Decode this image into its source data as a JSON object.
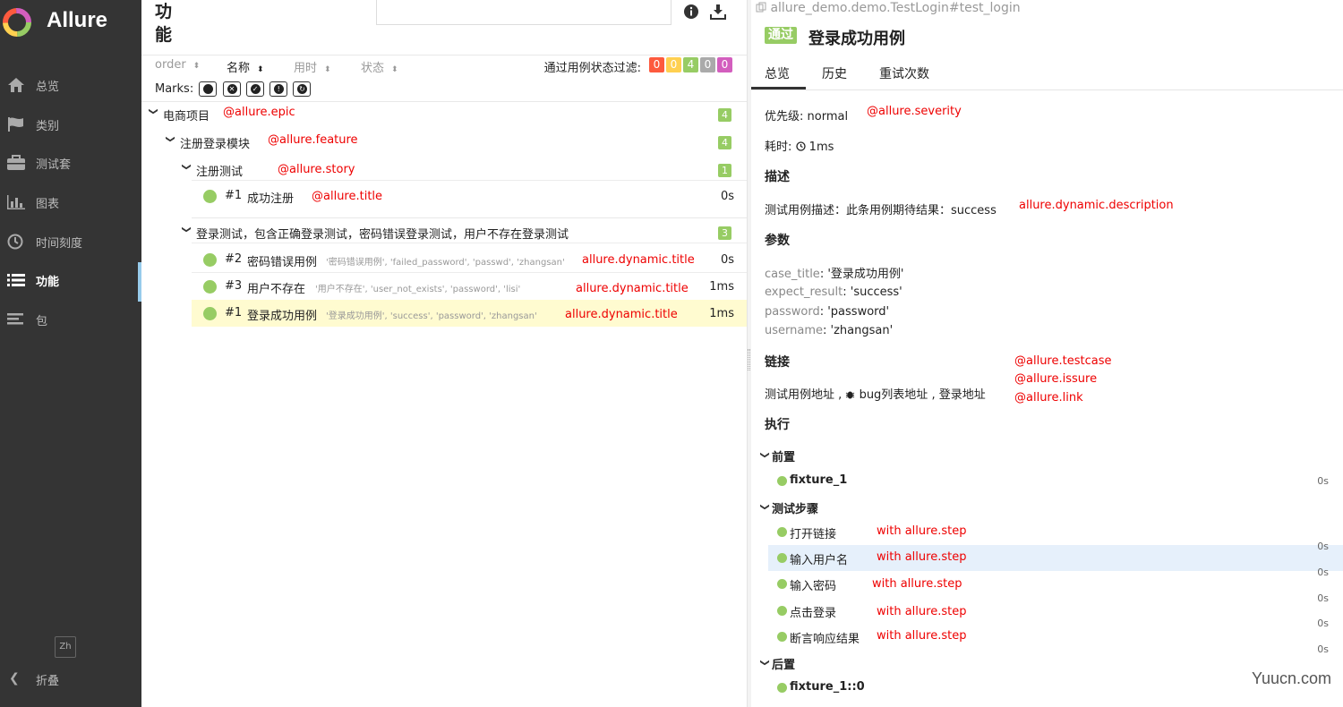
{
  "brand": {
    "name": "Allure"
  },
  "sidebar": {
    "items": [
      {
        "label": "总览",
        "icon": "home-icon"
      },
      {
        "label": "类别",
        "icon": "flag-icon"
      },
      {
        "label": "测试套",
        "icon": "briefcase-icon"
      },
      {
        "label": "图表",
        "icon": "bar-chart-icon"
      },
      {
        "label": "时间刻度",
        "icon": "clock-icon"
      },
      {
        "label": "功能",
        "icon": "list-icon"
      },
      {
        "label": "包",
        "icon": "align-left-icon"
      }
    ],
    "active": "功能",
    "language": "Zh",
    "collapse_label": "折叠"
  },
  "tree_pane": {
    "title": "功能",
    "sort_columns": [
      {
        "label": "order",
        "arrow": "⬍"
      },
      {
        "label": "名称",
        "arrow": "⬍"
      },
      {
        "label": "用时",
        "arrow": "⬍"
      },
      {
        "label": "状态",
        "arrow": "⬍"
      }
    ],
    "filter_label": "通过用例状态过滤:",
    "status_counts": [
      {
        "value": "0",
        "color": "#fd5a3e"
      },
      {
        "value": "0",
        "color": "#ffd050"
      },
      {
        "value": "4",
        "color": "#97cc64"
      },
      {
        "value": "0",
        "color": "#aaaaaa"
      },
      {
        "value": "0",
        "color": "#d35ebe"
      }
    ],
    "marks_label": "Marks:",
    "epic": {
      "label": "电商项目",
      "annotation": "@allure.epic",
      "count": "4"
    },
    "feature": {
      "label": "注册登录模块",
      "annotation": "@allure.feature",
      "count": "4"
    },
    "story_register": {
      "label": "注册测试",
      "annotation": "@allure.story",
      "count": "1"
    },
    "case_register": {
      "num": "#1",
      "name": "成功注册",
      "annotation": "@allure.title",
      "duration": "0s"
    },
    "story_login": {
      "label": "登录测试，包含正确登录测试，密码错误登录测试，用户不存在登录测试",
      "count": "3"
    },
    "login_cases": [
      {
        "num": "#2",
        "name": "密码错误用例",
        "params": "'密码错误用例', 'failed_password', 'passwd', 'zhangsan'",
        "annotation": "allure.dynamic.title",
        "duration": "0s"
      },
      {
        "num": "#3",
        "name": "用户不存在",
        "params": "'用户不存在', 'user_not_exists', 'password', 'lisi'",
        "annotation": "allure.dynamic.title",
        "duration": "1ms"
      },
      {
        "num": "#1",
        "name": "登录成功用例",
        "params": "'登录成功用例', 'success', 'password', 'zhangsan'",
        "annotation": "allure.dynamic.title",
        "duration": "1ms"
      }
    ]
  },
  "detail": {
    "breadcrumb": "allure_demo.demo.TestLogin#test_login",
    "status": "通过",
    "title": "登录成功用例",
    "tabs": [
      "总览",
      "历史",
      "重试次数"
    ],
    "severity_label": "优先级: normal",
    "severity_annotation": "@allure.severity",
    "duration_label": "耗时:",
    "duration_value": "1ms",
    "description_heading": "描述",
    "description_text": "测试用例描述：此条用例期待结果：success",
    "description_annotation": "allure.dynamic.description",
    "params_heading": "参数",
    "params": [
      {
        "key": "case_title",
        "value": ": '登录成功用例'"
      },
      {
        "key": "expect_result",
        "value": ": 'success'"
      },
      {
        "key": "password",
        "value": ": 'password'"
      },
      {
        "key": "username",
        "value": ": 'zhangsan'"
      }
    ],
    "links_heading": "链接",
    "link_testcase": "测试用例地址",
    "link_issue": "bug列表地址",
    "link_plain": "登录地址",
    "link_annotations": [
      "@allure.testcase",
      "@allure.issure",
      "@allure.link"
    ],
    "execution_heading": "执行",
    "setup_label": "前置",
    "setup_fixture": "fixture_1",
    "setup_duration": "0s",
    "steps_label": "测试步骤",
    "steps": [
      {
        "name": "打开链接",
        "annotation": "with allure.step",
        "duration": "0s"
      },
      {
        "name": "输入用户名",
        "annotation": "with allure.step",
        "duration": "0s"
      },
      {
        "name": "输入密码",
        "annotation": "with allure.step",
        "duration": "0s"
      },
      {
        "name": "点击登录",
        "annotation": "with allure.step",
        "duration": "0s"
      },
      {
        "name": "断言响应结果",
        "annotation": "with allure.step",
        "duration": "0s"
      }
    ],
    "teardown_label": "后置",
    "teardown_fixture": "fixture_1::0"
  },
  "watermark": "Yuucn.com"
}
